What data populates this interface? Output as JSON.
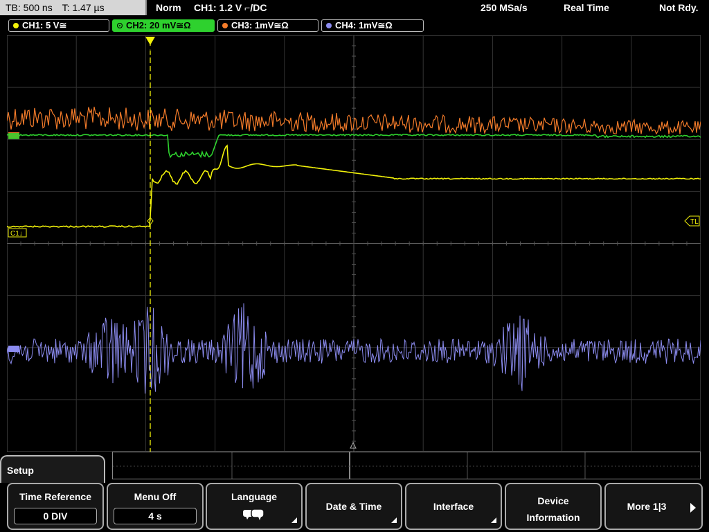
{
  "topbar": {
    "timebase": "TB: 500 ns",
    "trigger_time": "T: 1.47 µs",
    "mode": "Norm",
    "trigger_info": "CH1: 1.2 V ⌐/DC",
    "sample_rate": "250 MSa/s",
    "acq_mode": "Real Time",
    "status": "Not Rdy."
  },
  "channels": [
    {
      "label": "CH1: 5 V≅",
      "color": "#f2f20a"
    },
    {
      "label": "CH2: 20 mV≅Ω",
      "color": "#2ed12e"
    },
    {
      "label": "CH3: 1mV≅Ω",
      "color": "#f57c2a"
    },
    {
      "label": "CH4: 1mV≅Ω",
      "color": "#8c8cf0"
    }
  ],
  "markers": {
    "ch1_ref": "C1↓",
    "trigger_level": "TL"
  },
  "menu": {
    "title": "Setup",
    "softkeys": [
      {
        "label": "Time Reference",
        "value": "0 DIV"
      },
      {
        "label": "Menu Off",
        "value": "4 s"
      },
      {
        "label": "Language",
        "icon": "speech-bubbles-icon"
      },
      {
        "label": "Date & Time"
      },
      {
        "label": "Interface"
      },
      {
        "label": "Device",
        "label2": "Information"
      },
      {
        "label": "More 1|3"
      }
    ]
  }
}
